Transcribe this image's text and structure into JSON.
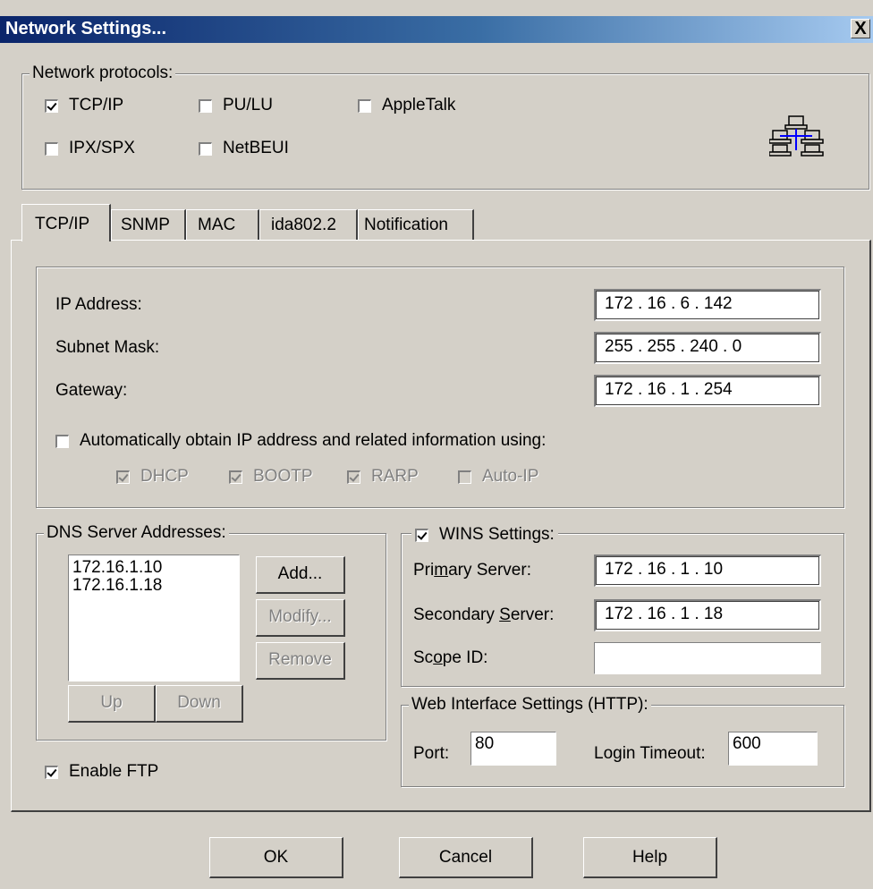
{
  "window": {
    "title": "Network Settings...",
    "close_label": "X"
  },
  "protocols": {
    "legend": "Network protocols:",
    "items": [
      {
        "label": "TCP/IP",
        "checked": true
      },
      {
        "label": "PU/LU",
        "checked": false
      },
      {
        "label": "AppleTalk",
        "checked": false
      },
      {
        "label": "IPX/SPX",
        "checked": false
      },
      {
        "label": "NetBEUI",
        "checked": false
      }
    ],
    "icon": "network-computers-icon"
  },
  "tabs": [
    "TCP/IP",
    "SNMP",
    "MAC",
    "ida802.2",
    "Notification"
  ],
  "active_tab": "TCP/IP",
  "ip": {
    "ip_label": "IP Address:",
    "ip_value": "172 .  16  .   6   . 142",
    "mask_label": "Subnet Mask:",
    "mask_value": "255 . 255 . 240 .   0",
    "gw_label": "Gateway:",
    "gw_value": "172 .  16  .   1   . 254",
    "auto_label": "Automatically obtain IP address and related information using:",
    "auto_checked": false,
    "methods": [
      {
        "label": "DHCP",
        "checked": true
      },
      {
        "label": "BOOTP",
        "checked": true
      },
      {
        "label": "RARP",
        "checked": true
      },
      {
        "label": "Auto-IP",
        "checked": false
      }
    ]
  },
  "dns": {
    "legend": "DNS Server Addresses:",
    "entries": [
      "172.16.1.10",
      "172.16.1.18"
    ],
    "add": "Add...",
    "modify": "Modify...",
    "remove": "Remove",
    "up": "Up",
    "down": "Down"
  },
  "ftp": {
    "label": "Enable FTP",
    "checked": true
  },
  "wins": {
    "legend": "WINS Settings:",
    "checked": true,
    "primary_label_pre": "Pri",
    "primary_label_u": "m",
    "primary_label_post": "ary Server:",
    "primary_value": "172 .  16  .   1   .  10",
    "secondary_label_pre": "Secondary ",
    "secondary_label_u": "S",
    "secondary_label_post": "erver:",
    "secondary_value": "172 .  16  .   1   .  18",
    "scope_label_pre": "Sc",
    "scope_label_u": "o",
    "scope_label_post": "pe ID:",
    "scope_value": ""
  },
  "web": {
    "legend": "Web Interface Settings (HTTP):",
    "port_label": "Port:",
    "port_value": "80",
    "timeout_label": "Login Timeout:",
    "timeout_value": "600"
  },
  "footer": {
    "ok": "OK",
    "cancel": "Cancel",
    "help": "Help"
  }
}
